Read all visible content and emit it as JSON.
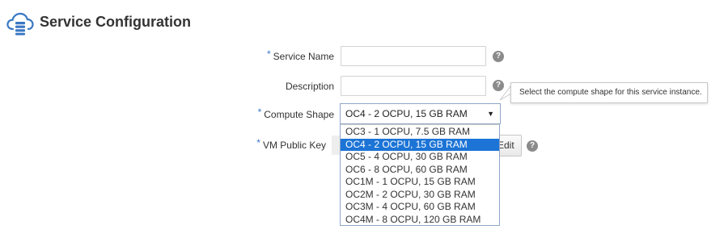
{
  "header": {
    "title": "Service Configuration",
    "icon": "cloud-database-icon"
  },
  "form": {
    "service_name": {
      "label": "Service Name",
      "required_marker": "*",
      "value": "",
      "help_icon": "question-icon"
    },
    "description": {
      "label": "Description",
      "value": "",
      "help_icon": "question-icon"
    },
    "compute_shape": {
      "label": "Compute Shape",
      "required_marker": "*",
      "selected": "OC4 - 2 OCPU, 15 GB RAM",
      "options": [
        "OC3 - 1 OCPU, 7.5 GB RAM",
        "OC4 - 2 OCPU, 15 GB RAM",
        "OC5 - 4 OCPU, 30 GB RAM",
        "OC6 - 8 OCPU, 60 GB RAM",
        "OC1M - 1 OCPU, 15 GB RAM",
        "OC2M - 2 OCPU, 30 GB RAM",
        "OC3M - 4 OCPU, 60 GB RAM",
        "OC4M - 8 OCPU, 120 GB RAM"
      ],
      "highlighted_option_index": 1,
      "tooltip": "Select the compute shape for this service instance."
    },
    "vm_public_key": {
      "label": "VM Public Key",
      "required_marker": "*",
      "edit_label": "Edit",
      "help_icon": "question-icon"
    }
  },
  "colors": {
    "accent": "#3a77c4",
    "highlight": "#1c74d6",
    "help_icon": "#8b8b8b",
    "title_text": "#333333"
  }
}
